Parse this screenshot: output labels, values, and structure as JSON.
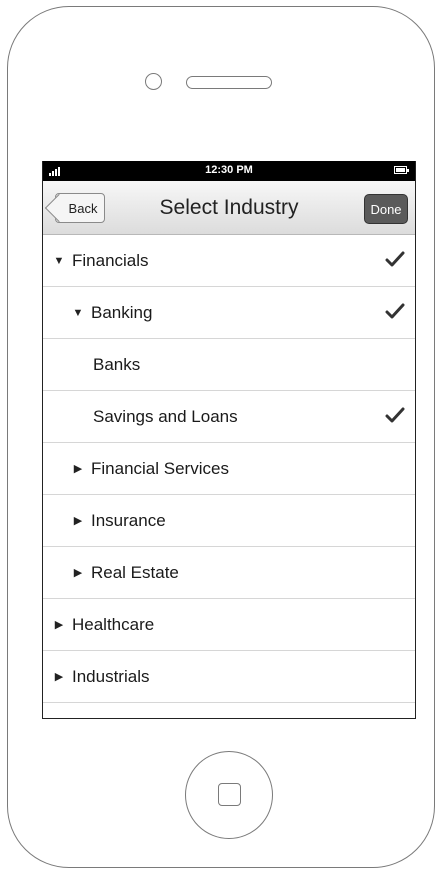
{
  "status_bar": {
    "time": "12:30 PM",
    "signal_icon": "signal-bars-icon",
    "battery_icon": "battery-icon"
  },
  "nav_bar": {
    "back_label": "Back",
    "title": "Select Industry",
    "done_label": "Done"
  },
  "list": {
    "rows": [
      {
        "label": "Financials",
        "level": 0,
        "expander": "expanded",
        "checked": true
      },
      {
        "label": "Banking",
        "level": 1,
        "expander": "expanded",
        "checked": true
      },
      {
        "label": "Banks",
        "level": 2,
        "expander": "none",
        "checked": false
      },
      {
        "label": "Savings and Loans",
        "level": 2,
        "expander": "none",
        "checked": true
      },
      {
        "label": "Financial Services",
        "level": 1,
        "expander": "collapsed",
        "checked": false
      },
      {
        "label": "Insurance",
        "level": 1,
        "expander": "collapsed",
        "checked": false
      },
      {
        "label": "Real Estate",
        "level": 1,
        "expander": "collapsed",
        "checked": false
      },
      {
        "label": "Healthcare",
        "level": 0,
        "expander": "collapsed",
        "checked": false
      },
      {
        "label": "Industrials",
        "level": 0,
        "expander": "collapsed",
        "checked": false
      }
    ]
  }
}
